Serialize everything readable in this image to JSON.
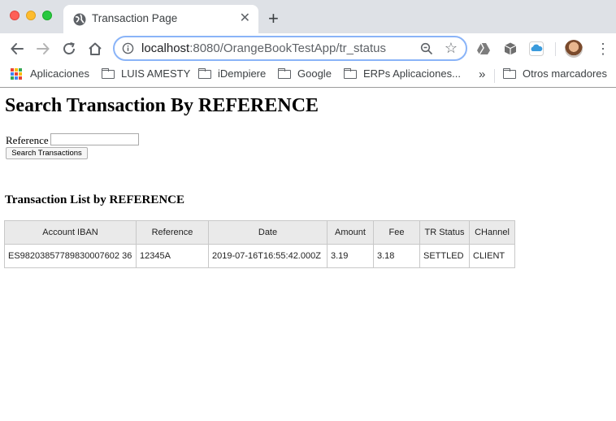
{
  "browser": {
    "tab_title": "Transaction Page",
    "new_tab_symbol": "+",
    "url_host": "localhost",
    "url_rest": ":8080/OrangeBookTestApp/tr_status",
    "bookmarks": {
      "apps": "Aplicaciones",
      "items": [
        "LUIS AMESTY",
        "iDempiere",
        "Google",
        "ERPs Aplicaciones..."
      ],
      "overflow": "»",
      "other": "Otros marcadores"
    }
  },
  "page": {
    "title": "Search Transaction By REFERENCE",
    "reference_label": "Reference",
    "reference_value": "",
    "search_button": "Search Transactions",
    "list_title": "Transaction List by REFERENCE",
    "table": {
      "columns": [
        "Account IBAN",
        "Reference",
        "Date",
        "Amount",
        "Fee",
        "TR Status",
        "CHannel"
      ],
      "rows": [
        [
          "ES98203857789830007602 36",
          "12345A",
          "2019-07-16T16:55:42.000Z",
          "3.19",
          "3.18",
          "SETTLED",
          "CLIENT"
        ]
      ]
    }
  },
  "colors": {
    "tabbar_bg": "#dee1e6",
    "omnibox_focus": "#8ab4f8",
    "table_header_bg": "#eaeaea"
  }
}
